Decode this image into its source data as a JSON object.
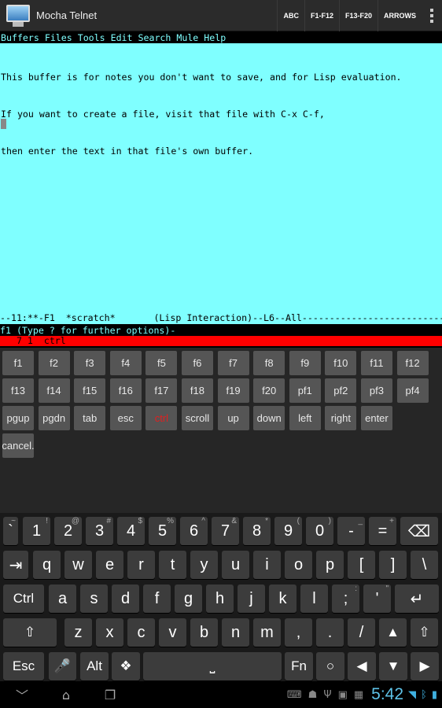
{
  "app": {
    "title": "Mocha Telnet"
  },
  "actionbar": {
    "buttons": [
      "ABC",
      "F1-F12",
      "F13-F20",
      "ARROWS"
    ]
  },
  "terminal": {
    "menubar": "Buffers Files Tools Edit Search Mule Help",
    "lines": [
      "This buffer is for notes you don't want to save, and for Lisp evaluation.",
      "If you want to create a file, visit that file with C-x C-f,",
      "then enter the text in that file's own buffer."
    ],
    "modeline": "--11:**-F1  *scratch*       (Lisp Interaction)--L6--All----------------------------------",
    "minibuffer": "f1 (Type ? for further options)-",
    "status": "   7 1  ctrl",
    "colors": {
      "buffer_bg": "#7fffff",
      "status_bg": "#ff0000"
    }
  },
  "fkeys": {
    "row1": [
      "f1",
      "f2",
      "f3",
      "f4",
      "f5",
      "f6",
      "f7",
      "f8",
      "f9",
      "f10",
      "f11",
      "f12"
    ],
    "row2": [
      "f13",
      "f14",
      "f15",
      "f16",
      "f17",
      "f18",
      "f19",
      "f20",
      "pf1",
      "pf2",
      "pf3",
      "pf4"
    ],
    "row3": [
      "pgup",
      "pgdn",
      "tab",
      "esc",
      "ctrl",
      "scroll",
      "up",
      "down",
      "left",
      "right",
      "enter"
    ],
    "row4": [
      "cancel."
    ]
  },
  "keyboard": {
    "row1": [
      {
        "k": "`",
        "a": "~"
      },
      {
        "k": "1",
        "a": "!"
      },
      {
        "k": "2",
        "a": "@"
      },
      {
        "k": "3",
        "a": "#"
      },
      {
        "k": "4",
        "a": "$"
      },
      {
        "k": "5",
        "a": "%"
      },
      {
        "k": "6",
        "a": "^"
      },
      {
        "k": "7",
        "a": "&"
      },
      {
        "k": "8",
        "a": "*"
      },
      {
        "k": "9",
        "a": "("
      },
      {
        "k": "0",
        "a": ")"
      },
      {
        "k": "-",
        "a": "_"
      },
      {
        "k": "=",
        "a": "+"
      },
      {
        "k": "⌫",
        "a": ""
      }
    ],
    "row2": [
      "⇥",
      "q",
      "w",
      "e",
      "r",
      "t",
      "y",
      "u",
      "i",
      "o",
      "p",
      "[",
      "]",
      "\\"
    ],
    "row3": [
      "Ctrl",
      "a",
      "s",
      "d",
      "f",
      "g",
      "h",
      "j",
      "k",
      "l",
      ";",
      "'",
      "↵"
    ],
    "row3_alts": {
      ";": ":",
      "'": "\""
    },
    "row4": [
      "⇧",
      "z",
      "x",
      "c",
      "v",
      "b",
      "n",
      "m",
      ",",
      ".",
      "/",
      "▲",
      "⇧"
    ],
    "row5": [
      "Esc",
      "🎤",
      "Alt",
      "❖",
      "⎵",
      "Fn",
      "○",
      "◀",
      "▼",
      "▶"
    ]
  },
  "status": {
    "time": "5:42"
  }
}
